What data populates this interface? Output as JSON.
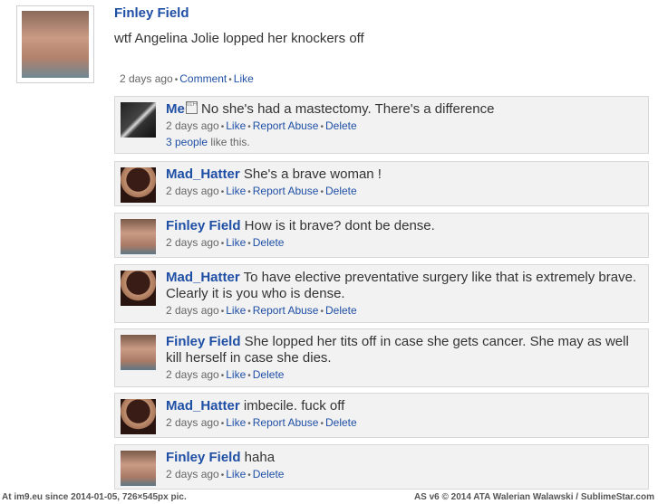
{
  "post": {
    "author": "Finley Field",
    "text": "wtf Angelina Jolie lopped her knockers off",
    "time": "2 days ago",
    "comment_label": "Comment",
    "like_label": "Like"
  },
  "comments": [
    {
      "author": "Me",
      "symbol": "01F600",
      "text": " No she's had a mastectomy. There's a difference",
      "time": "2 days ago",
      "like": "Like",
      "report": "Report Abuse",
      "delete": "Delete",
      "likes_link": "3 people",
      "likes_suffix": " like this.",
      "avatar": "me-avatar"
    },
    {
      "author": "Mad_Hatter",
      "text": " She's a brave woman !",
      "time": "2 days ago",
      "like": "Like",
      "report": "Report Abuse",
      "delete": "Delete",
      "avatar": "mad-hatter-avatar"
    },
    {
      "author": "Finley Field",
      "text": " How is it brave? dont be dense.",
      "time": "2 days ago",
      "like": "Like",
      "delete": "Delete",
      "avatar": "finley-avatar"
    },
    {
      "author": "Mad_Hatter",
      "text": " To have elective preventative surgery like that is extremely brave. Clearly it is you who is dense.",
      "time": "2 days ago",
      "like": "Like",
      "report": "Report Abuse",
      "delete": "Delete",
      "avatar": "mad-hatter-avatar"
    },
    {
      "author": "Finley Field",
      "text": " She lopped her tits off in case she gets cancer. She may as well kill herself in case she dies.",
      "time": "2 days ago",
      "like": "Like",
      "delete": "Delete",
      "avatar": "finley-avatar"
    },
    {
      "author": "Mad_Hatter",
      "text": " imbecile. fuck off",
      "time": "2 days ago",
      "like": "Like",
      "report": "Report Abuse",
      "delete": "Delete",
      "avatar": "mad-hatter-avatar"
    },
    {
      "author": "Finley Field",
      "text": " haha",
      "time": "2 days ago",
      "like": "Like",
      "delete": "Delete",
      "avatar": "finley-avatar"
    }
  ],
  "footer": {
    "left": "At im9.eu  since 2014-01-05, 726×545px pic.",
    "right": "AS v6 © 2014 ATA Walerian Walawski / SublimeStar.com"
  },
  "colors": {
    "link": "#1f4fa5",
    "comment_bg": "#f2f2f2"
  }
}
